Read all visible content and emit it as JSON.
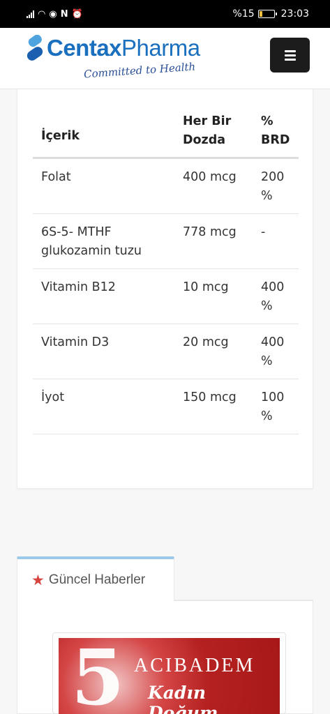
{
  "status_bar": {
    "battery": "%15",
    "time": "23:03"
  },
  "header": {
    "logo_name_bold": "Centax",
    "logo_name_light": "Pharma",
    "logo_tagline": "Committed to Health",
    "menu_icon": "hamburger-menu-icon"
  },
  "table": {
    "headers": {
      "ingredient": "İçerik",
      "dose_line1": "Her Bir",
      "dose_line2": "Dozda",
      "rda_line1": "%",
      "rda_line2": "BRD"
    },
    "rows": [
      {
        "ingredient_line1": "Folat",
        "ingredient_line2": "",
        "dose": "400 mcg",
        "rda": "200 %"
      },
      {
        "ingredient_line1": "6S-5- MTHF",
        "ingredient_line2": "glukozamin tuzu",
        "dose": "778 mcg",
        "rda": "-"
      },
      {
        "ingredient_line1": "Vitamin B12",
        "ingredient_line2": "",
        "dose": "10 mcg",
        "rda": "400 %"
      },
      {
        "ingredient_line1": "Vitamin D3",
        "ingredient_line2": "",
        "dose": "20 mcg",
        "rda": "400 %"
      },
      {
        "ingredient_line1": "İyot",
        "ingredient_line2": "",
        "dose": "150 mcg",
        "rda": "100 %"
      }
    ]
  },
  "news": {
    "tab_title": "Güncel Haberler",
    "tab_icon": "star-icon",
    "card": {
      "number": "5",
      "brand": "ACIBADEM",
      "subtitle": "Kadın Doğum"
    }
  },
  "colors": {
    "brand_blue": "#1a6fbf",
    "star_red": "#d7433e",
    "tab_accent": "#9bcbe8",
    "banner_red": "#b52121"
  }
}
